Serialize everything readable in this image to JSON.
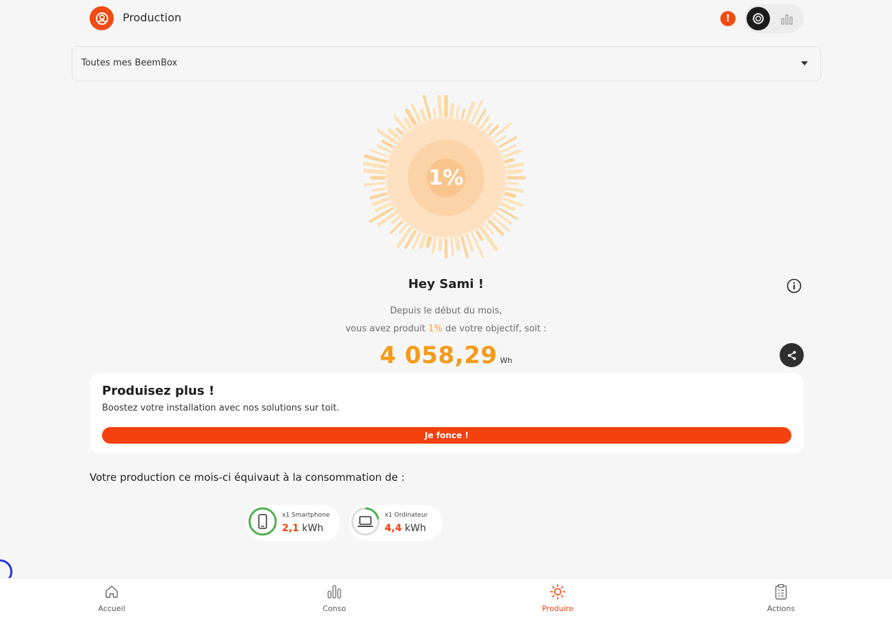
{
  "header": {
    "title": "Production",
    "alert_badge": "!"
  },
  "selector": {
    "value": "Toutes mes BeemBox"
  },
  "sun": {
    "percent_label": "1%",
    "progress_fraction": 0.01
  },
  "summary": {
    "greeting": "Hey Sami !",
    "line1": "Depuis le début du mois,",
    "line2_before": "vous avez produit ",
    "line2_pct": "1%",
    "line2_after": " de votre objectif, soit :",
    "energy_value": "4 058,29",
    "energy_unit": "Wh"
  },
  "promo": {
    "title": "Produisez plus !",
    "text": "Boostez votre installation avec nos solutions sur toit.",
    "button_label": "Je fonce !"
  },
  "equivalence": {
    "title": "Votre production ce mois-ci équivaut à la consommation de :",
    "items": [
      {
        "label": "x1 Smartphone",
        "value": "2,1",
        "unit": "kWh",
        "icon": "smartphone-icon"
      },
      {
        "label": "x1 Ordinateur",
        "value": "4,4",
        "unit": "kWh",
        "icon": "laptop-icon"
      }
    ]
  },
  "nav": {
    "items": [
      {
        "label": "Accueil",
        "icon": "home-icon"
      },
      {
        "label": "Conso",
        "icon": "bar-chart-icon"
      },
      {
        "label": "Produire",
        "icon": "sun-icon"
      },
      {
        "label": "Actions",
        "icon": "clipboard-icon"
      }
    ],
    "active": "Produire"
  },
  "colors": {
    "accent": "#f4410d",
    "energy": "#f49b1a",
    "ring_green": "#4cb050"
  }
}
